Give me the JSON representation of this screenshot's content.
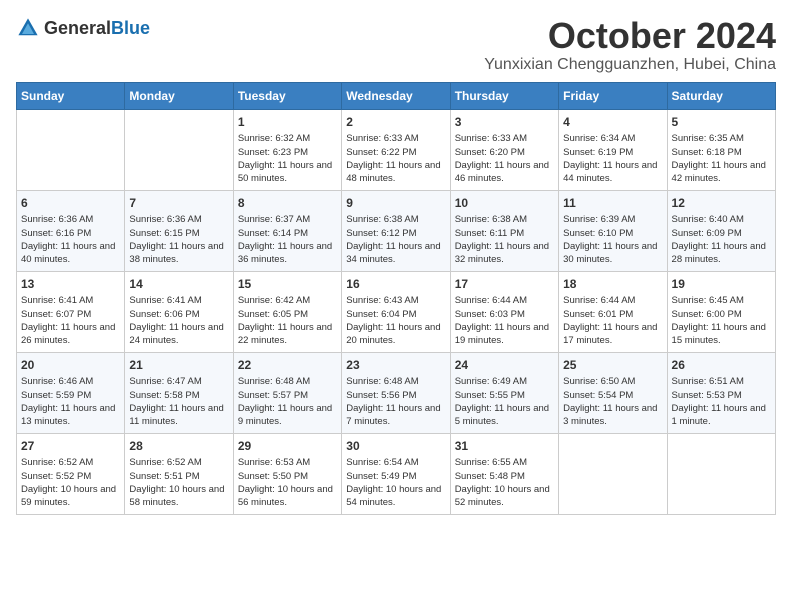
{
  "header": {
    "logo_general": "General",
    "logo_blue": "Blue",
    "month": "October 2024",
    "location": "Yunxixian Chengguanzhen, Hubei, China"
  },
  "weekdays": [
    "Sunday",
    "Monday",
    "Tuesday",
    "Wednesday",
    "Thursday",
    "Friday",
    "Saturday"
  ],
  "weeks": [
    [
      {
        "day": "",
        "sunrise": "",
        "sunset": "",
        "daylight": ""
      },
      {
        "day": "",
        "sunrise": "",
        "sunset": "",
        "daylight": ""
      },
      {
        "day": "1",
        "sunrise": "Sunrise: 6:32 AM",
        "sunset": "Sunset: 6:23 PM",
        "daylight": "Daylight: 11 hours and 50 minutes."
      },
      {
        "day": "2",
        "sunrise": "Sunrise: 6:33 AM",
        "sunset": "Sunset: 6:22 PM",
        "daylight": "Daylight: 11 hours and 48 minutes."
      },
      {
        "day": "3",
        "sunrise": "Sunrise: 6:33 AM",
        "sunset": "Sunset: 6:20 PM",
        "daylight": "Daylight: 11 hours and 46 minutes."
      },
      {
        "day": "4",
        "sunrise": "Sunrise: 6:34 AM",
        "sunset": "Sunset: 6:19 PM",
        "daylight": "Daylight: 11 hours and 44 minutes."
      },
      {
        "day": "5",
        "sunrise": "Sunrise: 6:35 AM",
        "sunset": "Sunset: 6:18 PM",
        "daylight": "Daylight: 11 hours and 42 minutes."
      }
    ],
    [
      {
        "day": "6",
        "sunrise": "Sunrise: 6:36 AM",
        "sunset": "Sunset: 6:16 PM",
        "daylight": "Daylight: 11 hours and 40 minutes."
      },
      {
        "day": "7",
        "sunrise": "Sunrise: 6:36 AM",
        "sunset": "Sunset: 6:15 PM",
        "daylight": "Daylight: 11 hours and 38 minutes."
      },
      {
        "day": "8",
        "sunrise": "Sunrise: 6:37 AM",
        "sunset": "Sunset: 6:14 PM",
        "daylight": "Daylight: 11 hours and 36 minutes."
      },
      {
        "day": "9",
        "sunrise": "Sunrise: 6:38 AM",
        "sunset": "Sunset: 6:12 PM",
        "daylight": "Daylight: 11 hours and 34 minutes."
      },
      {
        "day": "10",
        "sunrise": "Sunrise: 6:38 AM",
        "sunset": "Sunset: 6:11 PM",
        "daylight": "Daylight: 11 hours and 32 minutes."
      },
      {
        "day": "11",
        "sunrise": "Sunrise: 6:39 AM",
        "sunset": "Sunset: 6:10 PM",
        "daylight": "Daylight: 11 hours and 30 minutes."
      },
      {
        "day": "12",
        "sunrise": "Sunrise: 6:40 AM",
        "sunset": "Sunset: 6:09 PM",
        "daylight": "Daylight: 11 hours and 28 minutes."
      }
    ],
    [
      {
        "day": "13",
        "sunrise": "Sunrise: 6:41 AM",
        "sunset": "Sunset: 6:07 PM",
        "daylight": "Daylight: 11 hours and 26 minutes."
      },
      {
        "day": "14",
        "sunrise": "Sunrise: 6:41 AM",
        "sunset": "Sunset: 6:06 PM",
        "daylight": "Daylight: 11 hours and 24 minutes."
      },
      {
        "day": "15",
        "sunrise": "Sunrise: 6:42 AM",
        "sunset": "Sunset: 6:05 PM",
        "daylight": "Daylight: 11 hours and 22 minutes."
      },
      {
        "day": "16",
        "sunrise": "Sunrise: 6:43 AM",
        "sunset": "Sunset: 6:04 PM",
        "daylight": "Daylight: 11 hours and 20 minutes."
      },
      {
        "day": "17",
        "sunrise": "Sunrise: 6:44 AM",
        "sunset": "Sunset: 6:03 PM",
        "daylight": "Daylight: 11 hours and 19 minutes."
      },
      {
        "day": "18",
        "sunrise": "Sunrise: 6:44 AM",
        "sunset": "Sunset: 6:01 PM",
        "daylight": "Daylight: 11 hours and 17 minutes."
      },
      {
        "day": "19",
        "sunrise": "Sunrise: 6:45 AM",
        "sunset": "Sunset: 6:00 PM",
        "daylight": "Daylight: 11 hours and 15 minutes."
      }
    ],
    [
      {
        "day": "20",
        "sunrise": "Sunrise: 6:46 AM",
        "sunset": "Sunset: 5:59 PM",
        "daylight": "Daylight: 11 hours and 13 minutes."
      },
      {
        "day": "21",
        "sunrise": "Sunrise: 6:47 AM",
        "sunset": "Sunset: 5:58 PM",
        "daylight": "Daylight: 11 hours and 11 minutes."
      },
      {
        "day": "22",
        "sunrise": "Sunrise: 6:48 AM",
        "sunset": "Sunset: 5:57 PM",
        "daylight": "Daylight: 11 hours and 9 minutes."
      },
      {
        "day": "23",
        "sunrise": "Sunrise: 6:48 AM",
        "sunset": "Sunset: 5:56 PM",
        "daylight": "Daylight: 11 hours and 7 minutes."
      },
      {
        "day": "24",
        "sunrise": "Sunrise: 6:49 AM",
        "sunset": "Sunset: 5:55 PM",
        "daylight": "Daylight: 11 hours and 5 minutes."
      },
      {
        "day": "25",
        "sunrise": "Sunrise: 6:50 AM",
        "sunset": "Sunset: 5:54 PM",
        "daylight": "Daylight: 11 hours and 3 minutes."
      },
      {
        "day": "26",
        "sunrise": "Sunrise: 6:51 AM",
        "sunset": "Sunset: 5:53 PM",
        "daylight": "Daylight: 11 hours and 1 minute."
      }
    ],
    [
      {
        "day": "27",
        "sunrise": "Sunrise: 6:52 AM",
        "sunset": "Sunset: 5:52 PM",
        "daylight": "Daylight: 10 hours and 59 minutes."
      },
      {
        "day": "28",
        "sunrise": "Sunrise: 6:52 AM",
        "sunset": "Sunset: 5:51 PM",
        "daylight": "Daylight: 10 hours and 58 minutes."
      },
      {
        "day": "29",
        "sunrise": "Sunrise: 6:53 AM",
        "sunset": "Sunset: 5:50 PM",
        "daylight": "Daylight: 10 hours and 56 minutes."
      },
      {
        "day": "30",
        "sunrise": "Sunrise: 6:54 AM",
        "sunset": "Sunset: 5:49 PM",
        "daylight": "Daylight: 10 hours and 54 minutes."
      },
      {
        "day": "31",
        "sunrise": "Sunrise: 6:55 AM",
        "sunset": "Sunset: 5:48 PM",
        "daylight": "Daylight: 10 hours and 52 minutes."
      },
      {
        "day": "",
        "sunrise": "",
        "sunset": "",
        "daylight": ""
      },
      {
        "day": "",
        "sunrise": "",
        "sunset": "",
        "daylight": ""
      }
    ]
  ]
}
